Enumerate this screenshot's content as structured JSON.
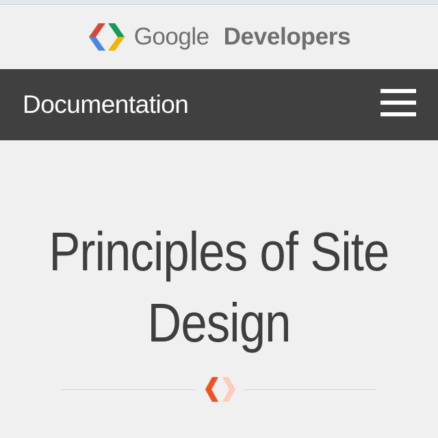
{
  "header": {
    "brand_google": "Google",
    "brand_developers": "Developers",
    "logo_icon": "google-developers-logo-icon"
  },
  "nav": {
    "title": "Documentation",
    "menu_icon": "hamburger-menu-icon"
  },
  "main": {
    "title": "Principles of Site Design",
    "divider_icon": "chevron-brackets-icon"
  },
  "colors": {
    "nav_background": "#404040",
    "page_background": "#f0f0f0",
    "title_text": "#3e3e3e",
    "logo_blue": "#4a86e8",
    "logo_red": "#db4437",
    "logo_green": "#0f9d58",
    "logo_yellow": "#f4b400",
    "accent_orange": "#f4511e",
    "accent_light": "#ffccbc"
  }
}
